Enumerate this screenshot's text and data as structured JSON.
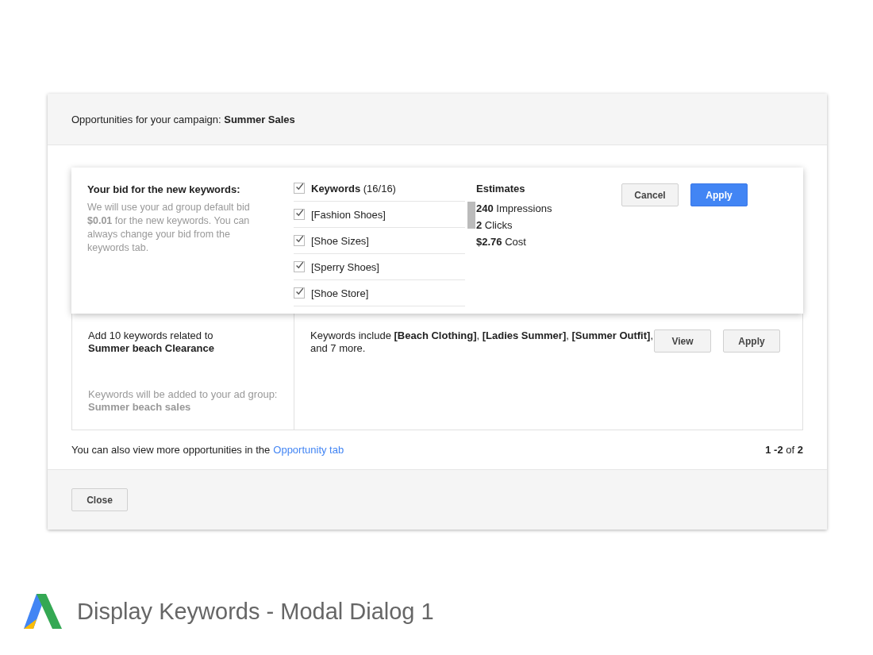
{
  "dialog": {
    "title": "Opportunities for your campaign: **Summer Sales**"
  },
  "bid_panel": {
    "heading": "Your bid for the new keywords:",
    "description": "We will use your ad group default bid **$0.01** for the new keywords. You can always change your bid from the keywords tab.",
    "keywords_header": {
      "label": "**Keywords** (16/16)",
      "checked": true
    },
    "keywords": [
      {
        "label": "[Fashion Shoes]",
        "checked": true
      },
      {
        "label": "[Shoe Sizes]",
        "checked": true
      },
      {
        "label": "[Sperry Shoes]",
        "checked": true
      },
      {
        "label": "[Shoe Store]",
        "checked": true
      }
    ],
    "estimates": {
      "heading": "Estimates",
      "lines": [
        "**240** Impressions",
        "**2** Clicks",
        "**$2.76** Cost"
      ]
    },
    "buttons": [
      {
        "label": "Cancel",
        "kind": "default"
      },
      {
        "label": "Apply",
        "kind": "primary"
      }
    ]
  },
  "opportunity": {
    "title": "Add 10 keywords related to",
    "topic": "Summer beach Clearance",
    "note": "Keywords will be added to your ad group:",
    "ad_group": "Summer beach sales",
    "summary": "Keywords include **[Beach Clothing]**, **[Ladies Summer]**, **[Summer Outfit]**, and 7 more.",
    "buttons": [
      {
        "label": "View",
        "kind": "default"
      },
      {
        "label": "Apply",
        "kind": "default"
      }
    ]
  },
  "footer": {
    "text": "You can also view more opportunities in the",
    "link": "Opportunity tab",
    "pagination": "**1 -2** of **2**"
  },
  "close_button": "Close",
  "caption": "Display Keywords - Modal Dialog 1"
}
